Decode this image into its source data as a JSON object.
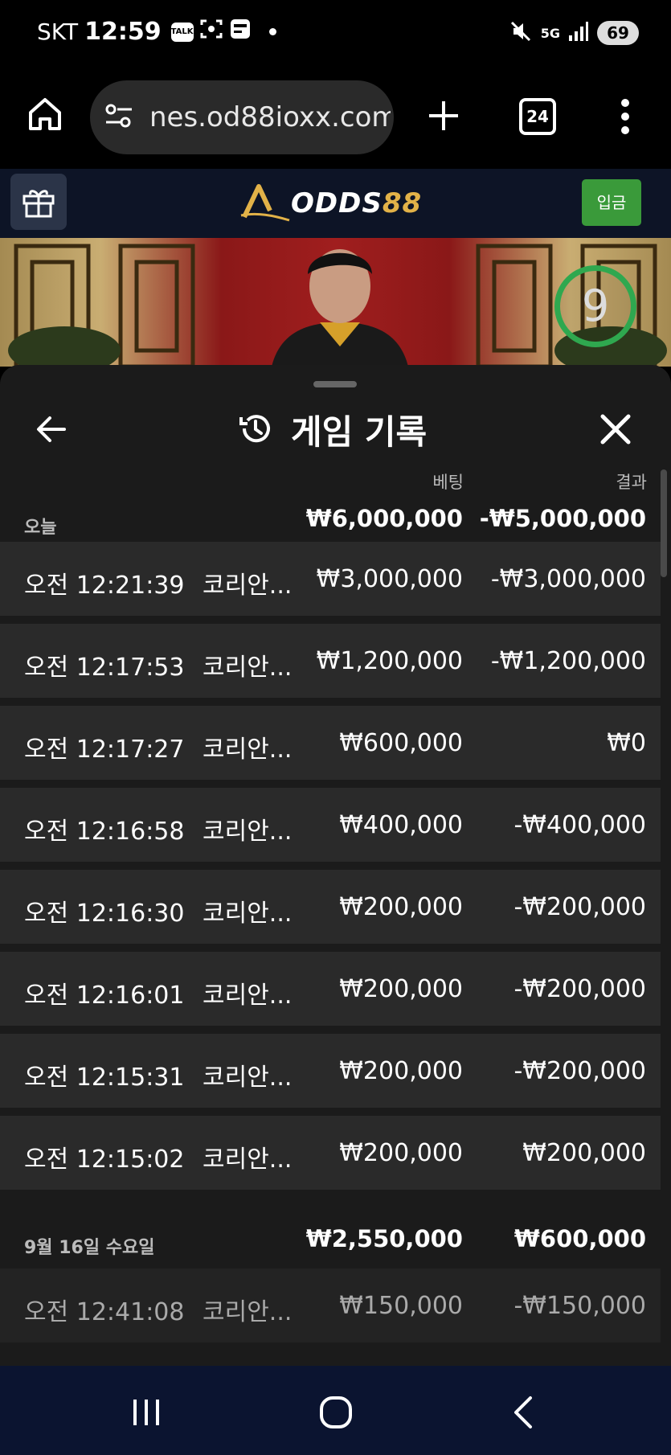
{
  "status_bar": {
    "carrier": "SKT",
    "time": "12:59",
    "notif_icons": [
      "talk-icon",
      "scan-icon",
      "pay-icon"
    ],
    "talk_label": "TALK",
    "network": "5G",
    "battery": "69"
  },
  "browser": {
    "url": "nes.od88ioxx.com",
    "tab_count": "24"
  },
  "site": {
    "logo_main": "ODDS",
    "logo_accent": "88",
    "deposit_label": "입금",
    "accent_color": "#e2b248",
    "green_color": "#3a9a3a"
  },
  "video": {
    "countdown": "9"
  },
  "history": {
    "title": "게임 기록",
    "col_bet": "베팅",
    "col_result": "결과",
    "groups": [
      {
        "label": "오늘",
        "bet_total": "₩6,000,000",
        "result_total": "-₩5,000,000",
        "rows": [
          {
            "time": "오전 12:21:39",
            "game": "코리안...",
            "bet": "₩3,000,000",
            "result": "-₩3,000,000"
          },
          {
            "time": "오전 12:17:53",
            "game": "코리안...",
            "bet": "₩1,200,000",
            "result": "-₩1,200,000"
          },
          {
            "time": "오전 12:17:27",
            "game": "코리안...",
            "bet": "₩600,000",
            "result": "₩0"
          },
          {
            "time": "오전 12:16:58",
            "game": "코리안...",
            "bet": "₩400,000",
            "result": "-₩400,000"
          },
          {
            "time": "오전 12:16:30",
            "game": "코리안...",
            "bet": "₩200,000",
            "result": "-₩200,000"
          },
          {
            "time": "오전 12:16:01",
            "game": "코리안...",
            "bet": "₩200,000",
            "result": "-₩200,000"
          },
          {
            "time": "오전 12:15:31",
            "game": "코리안...",
            "bet": "₩200,000",
            "result": "-₩200,000"
          },
          {
            "time": "오전 12:15:02",
            "game": "코리안...",
            "bet": "₩200,000",
            "result": "₩200,000"
          }
        ]
      },
      {
        "label": "9월 16일 수요일",
        "bet_total": "₩2,550,000",
        "result_total": "₩600,000",
        "rows": [
          {
            "time": "오전 12:41:08",
            "game": "코리안...",
            "bet": "₩150,000",
            "result": "-₩150,000"
          }
        ]
      }
    ]
  }
}
